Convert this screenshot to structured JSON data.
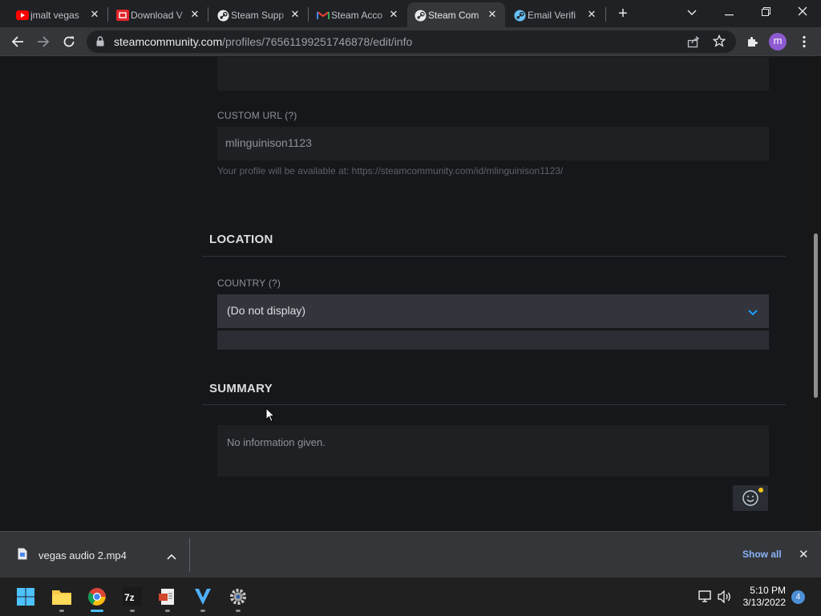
{
  "browser": {
    "tabs": [
      {
        "title": "jmalt vegas",
        "icon": "youtube-icon",
        "active": false
      },
      {
        "title": "Download V",
        "icon": "download-site-icon",
        "active": false
      },
      {
        "title": "Steam Supp",
        "icon": "steam-icon",
        "active": false
      },
      {
        "title": "Steam Acco",
        "icon": "gmail-icon",
        "active": false
      },
      {
        "title": "Steam Com",
        "icon": "steam-icon",
        "active": true
      },
      {
        "title": "Email Verifi",
        "icon": "steam-icon",
        "active": false
      }
    ],
    "url_host": "steamcommunity.com",
    "url_path": "/profiles/76561199251746878/edit/info",
    "profile_initial": "m"
  },
  "page": {
    "custom_url": {
      "label": "CUSTOM URL (?)",
      "value": "mlinguinison1123",
      "hint": "Your profile will be available at: https://steamcommunity.com/id/mlinguinison1123/"
    },
    "location": {
      "title": "LOCATION",
      "country_label": "COUNTRY (?)",
      "country_value": "(Do not display)"
    },
    "summary": {
      "title": "SUMMARY",
      "text": "No information given."
    }
  },
  "downloads": {
    "file_name": "vegas audio 2.mp4",
    "show_all": "Show all"
  },
  "taskbar": {
    "time": "5:10 PM",
    "date": "3/13/2022",
    "notification_count": "4"
  },
  "colors": {
    "steam_accent": "#1a9fff",
    "page_bg": "#16171a"
  }
}
